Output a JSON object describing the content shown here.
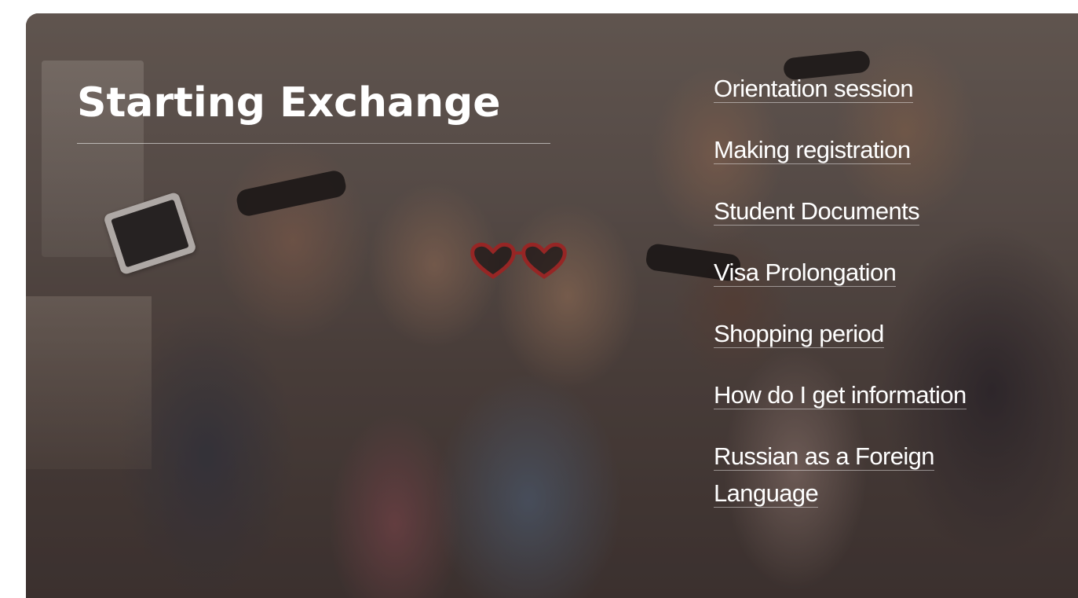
{
  "banner": {
    "title": "Starting Exchange",
    "background_image": "group-selfie-photo"
  },
  "menu": {
    "items": [
      {
        "label": "Orientation session"
      },
      {
        "label": "Making registration"
      },
      {
        "label": "Student Documents"
      },
      {
        "label": "Visa Prolongation"
      },
      {
        "label": "Shopping period"
      },
      {
        "label": "How do I get information"
      },
      {
        "label": "Russian as a Foreign Language"
      }
    ]
  },
  "colors": {
    "text": "#ffffff",
    "underline": "rgba(255,255,255,0.45)"
  }
}
